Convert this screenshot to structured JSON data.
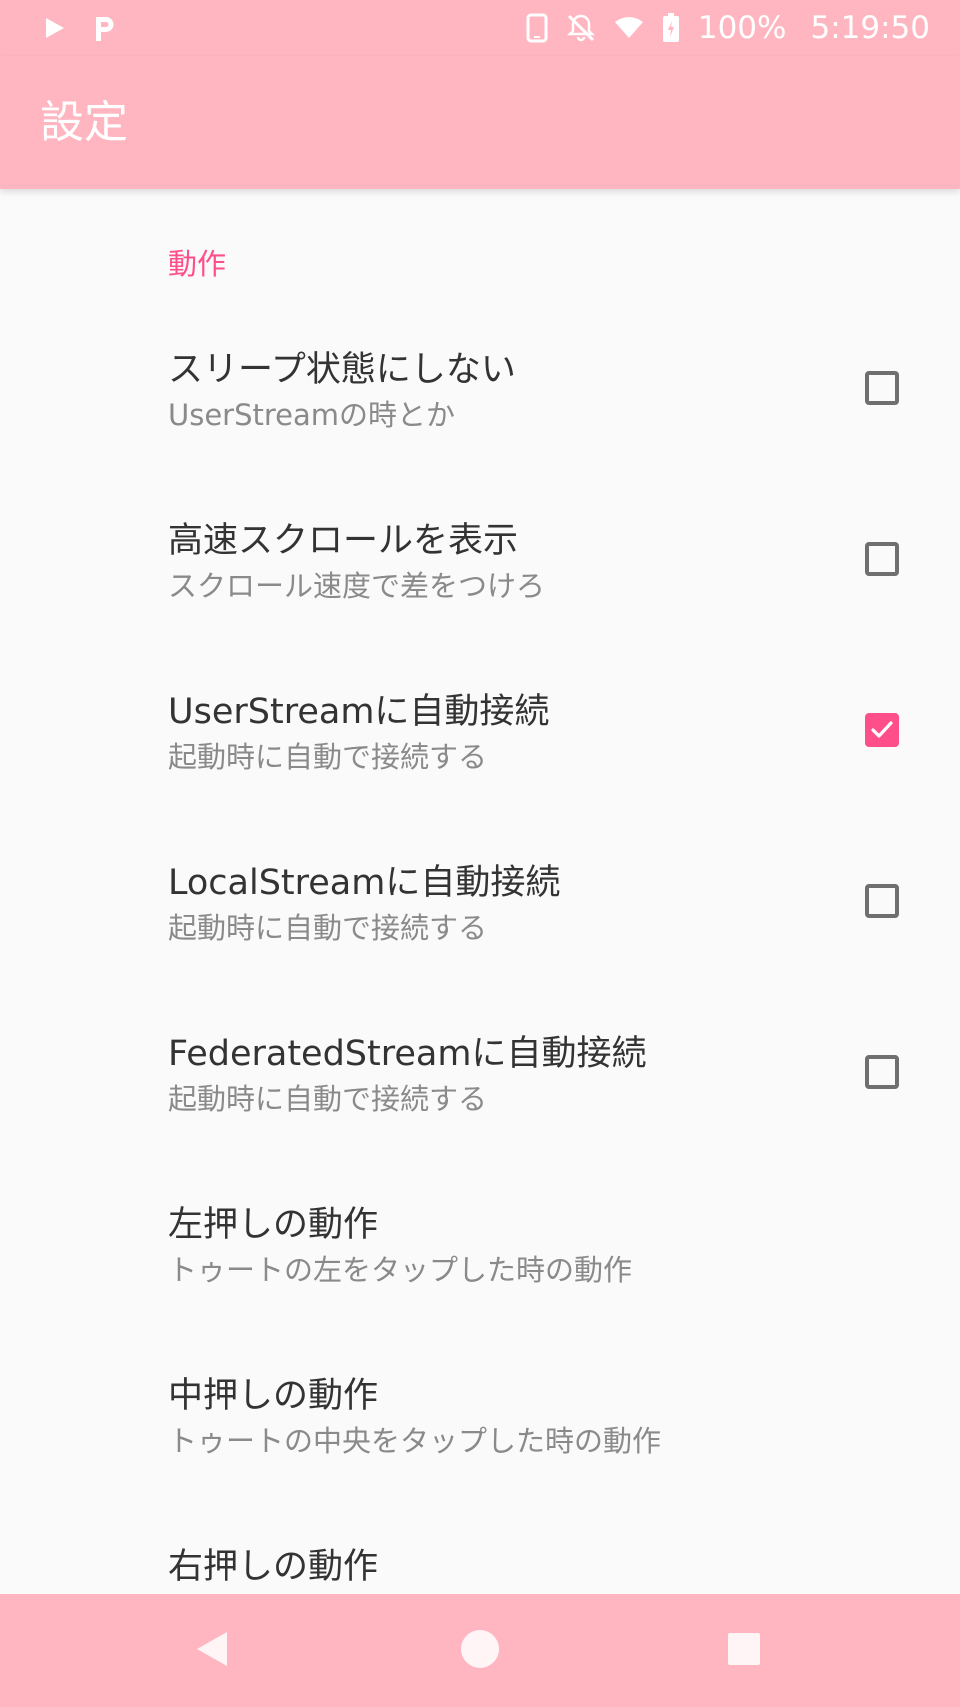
{
  "status_bar": {
    "icons_left": [
      "play-icon",
      "parking-icon"
    ],
    "icons_right": [
      "phone-icon",
      "notifications-off-icon",
      "wifi-icon",
      "battery-icon"
    ],
    "battery": "100%",
    "time": "5:19:50"
  },
  "app_bar": {
    "title": "設定"
  },
  "settings": {
    "category": "動作",
    "items": [
      {
        "title": "スリープ状態にしない",
        "summary": "UserStreamの時とか",
        "checkbox": true,
        "checked": false
      },
      {
        "title": "高速スクロールを表示",
        "summary": "スクロール速度で差をつけろ",
        "checkbox": true,
        "checked": false
      },
      {
        "title": "UserStreamに自動接続",
        "summary": "起動時に自動で接続する",
        "checkbox": true,
        "checked": true
      },
      {
        "title": "LocalStreamに自動接続",
        "summary": "起動時に自動で接続する",
        "checkbox": true,
        "checked": false
      },
      {
        "title": "FederatedStreamに自動接続",
        "summary": "起動時に自動で接続する",
        "checkbox": true,
        "checked": false
      },
      {
        "title": "左押しの動作",
        "summary": "トゥートの左をタップした時の動作",
        "checkbox": false
      },
      {
        "title": "中押しの動作",
        "summary": "トゥートの中央をタップした時の動作",
        "checkbox": false
      },
      {
        "title": "右押しの動作",
        "summary": "",
        "checkbox": false
      }
    ]
  },
  "nav_bar": {
    "buttons": [
      "back-icon",
      "home-icon",
      "recents-icon"
    ]
  },
  "colors": {
    "primary": "#ffb6c1",
    "accent": "#ff4f8b",
    "background": "#fafafa",
    "title_text": "#333333",
    "summary_text": "#8a8a8a"
  }
}
